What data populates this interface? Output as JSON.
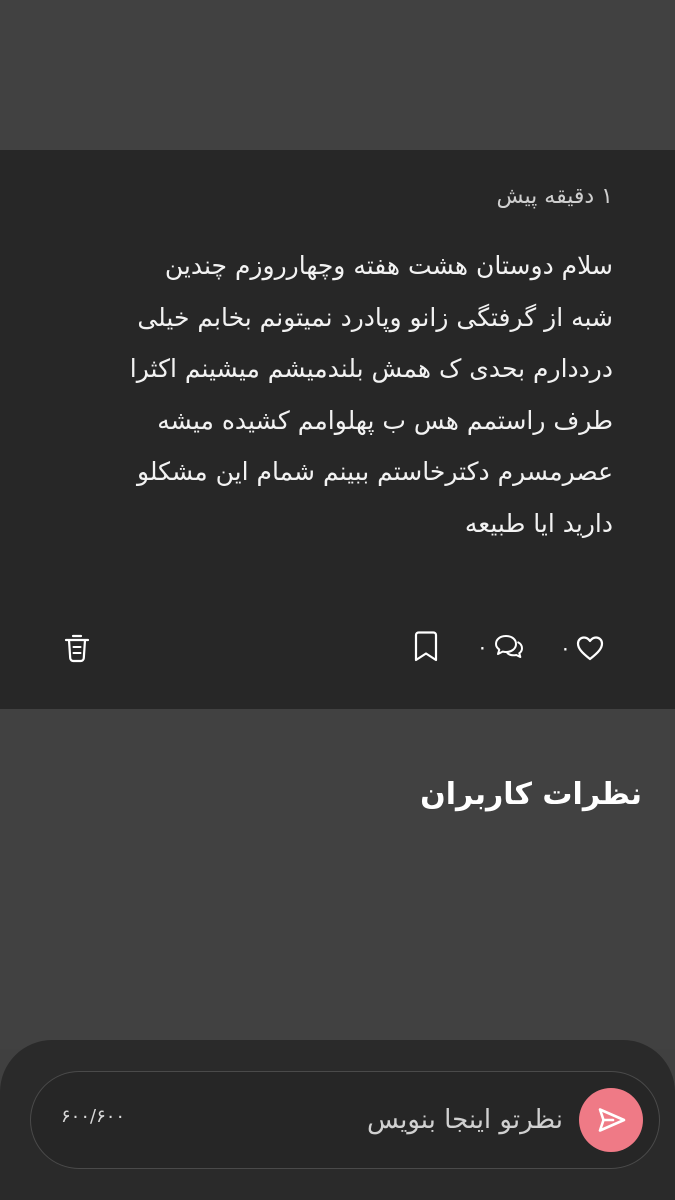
{
  "post": {
    "time": "۱ دقیقه پیش",
    "body": "سلام دوستان هشت هفته وچهارروزم چندین\nشبه از گرفتگی زانو وپادرد نمیتونم بخابم خیلی\nدرددارم بحدی ک همش بلندمیشم میشینم اکثرا\nطرف راستمم هس ب پهلوامم کشیده میشه\nعصرمسرم دکترخاستم ببینم شمام این مشکلو\nدارید ایا طبیعه",
    "actions": {
      "like_count": "۰",
      "comment_count": "۰",
      "like_icon": "heart-icon",
      "comment_icon": "chat-bubbles-icon",
      "bookmark_icon": "bookmark-icon",
      "delete_icon": "trash-icon"
    }
  },
  "comments": {
    "title": "نظرات کاربران"
  },
  "composer": {
    "placeholder": "نظرتو اینجا بنویس",
    "counter": "۶۰۰/۶۰۰",
    "send_icon": "send-icon",
    "accent": "#ef7a86"
  }
}
